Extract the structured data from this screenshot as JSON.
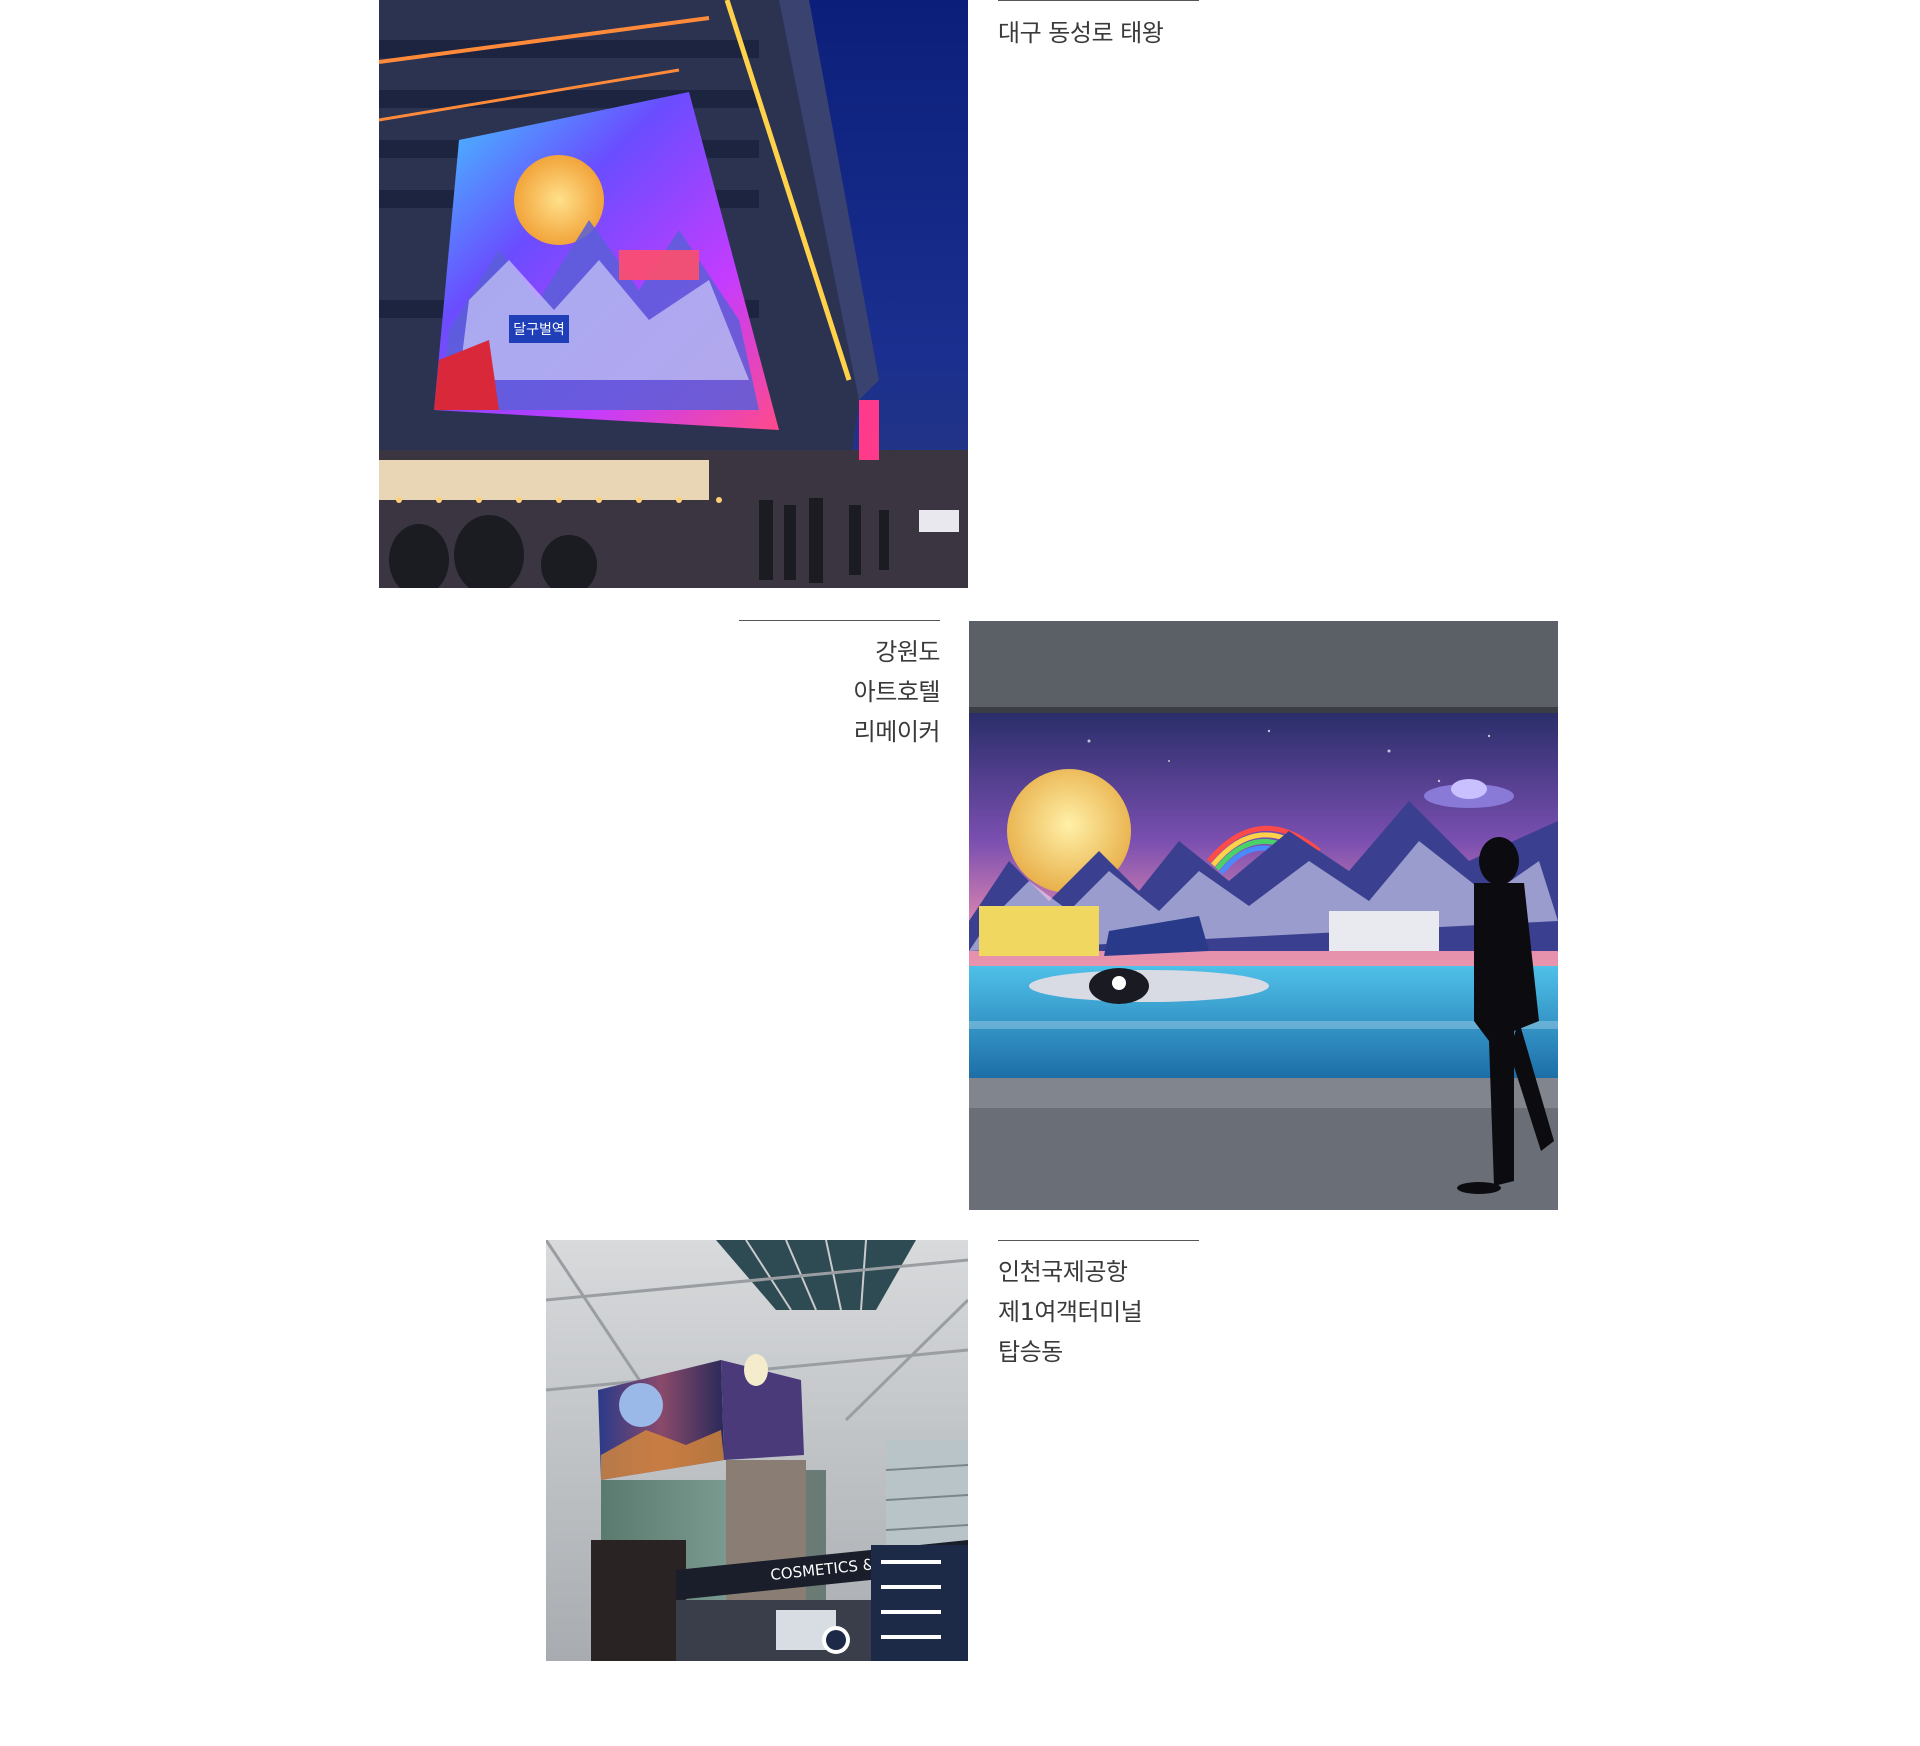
{
  "gallery": {
    "items": [
      {
        "photo_name": "daegu-dongseongro-photo",
        "caption_lines": [
          "대구 동성로 태왕"
        ]
      },
      {
        "photo_name": "gangwon-art-hotel-photo",
        "caption_lines": [
          "강원도",
          "아트호텔",
          "리메이커"
        ]
      },
      {
        "photo_name": "incheon-airport-photo",
        "caption_lines": [
          "인천국제공항",
          "제1여객터미널",
          "탑승동"
        ]
      }
    ],
    "photo_signage": {
      "daegu_station_sign": "달구벌역",
      "airport_store_sign": "COSMETICS & PERFUMES"
    }
  },
  "colors": {
    "caption_text": "#3a3a3a",
    "rule": "#555555",
    "background": "#ffffff"
  }
}
